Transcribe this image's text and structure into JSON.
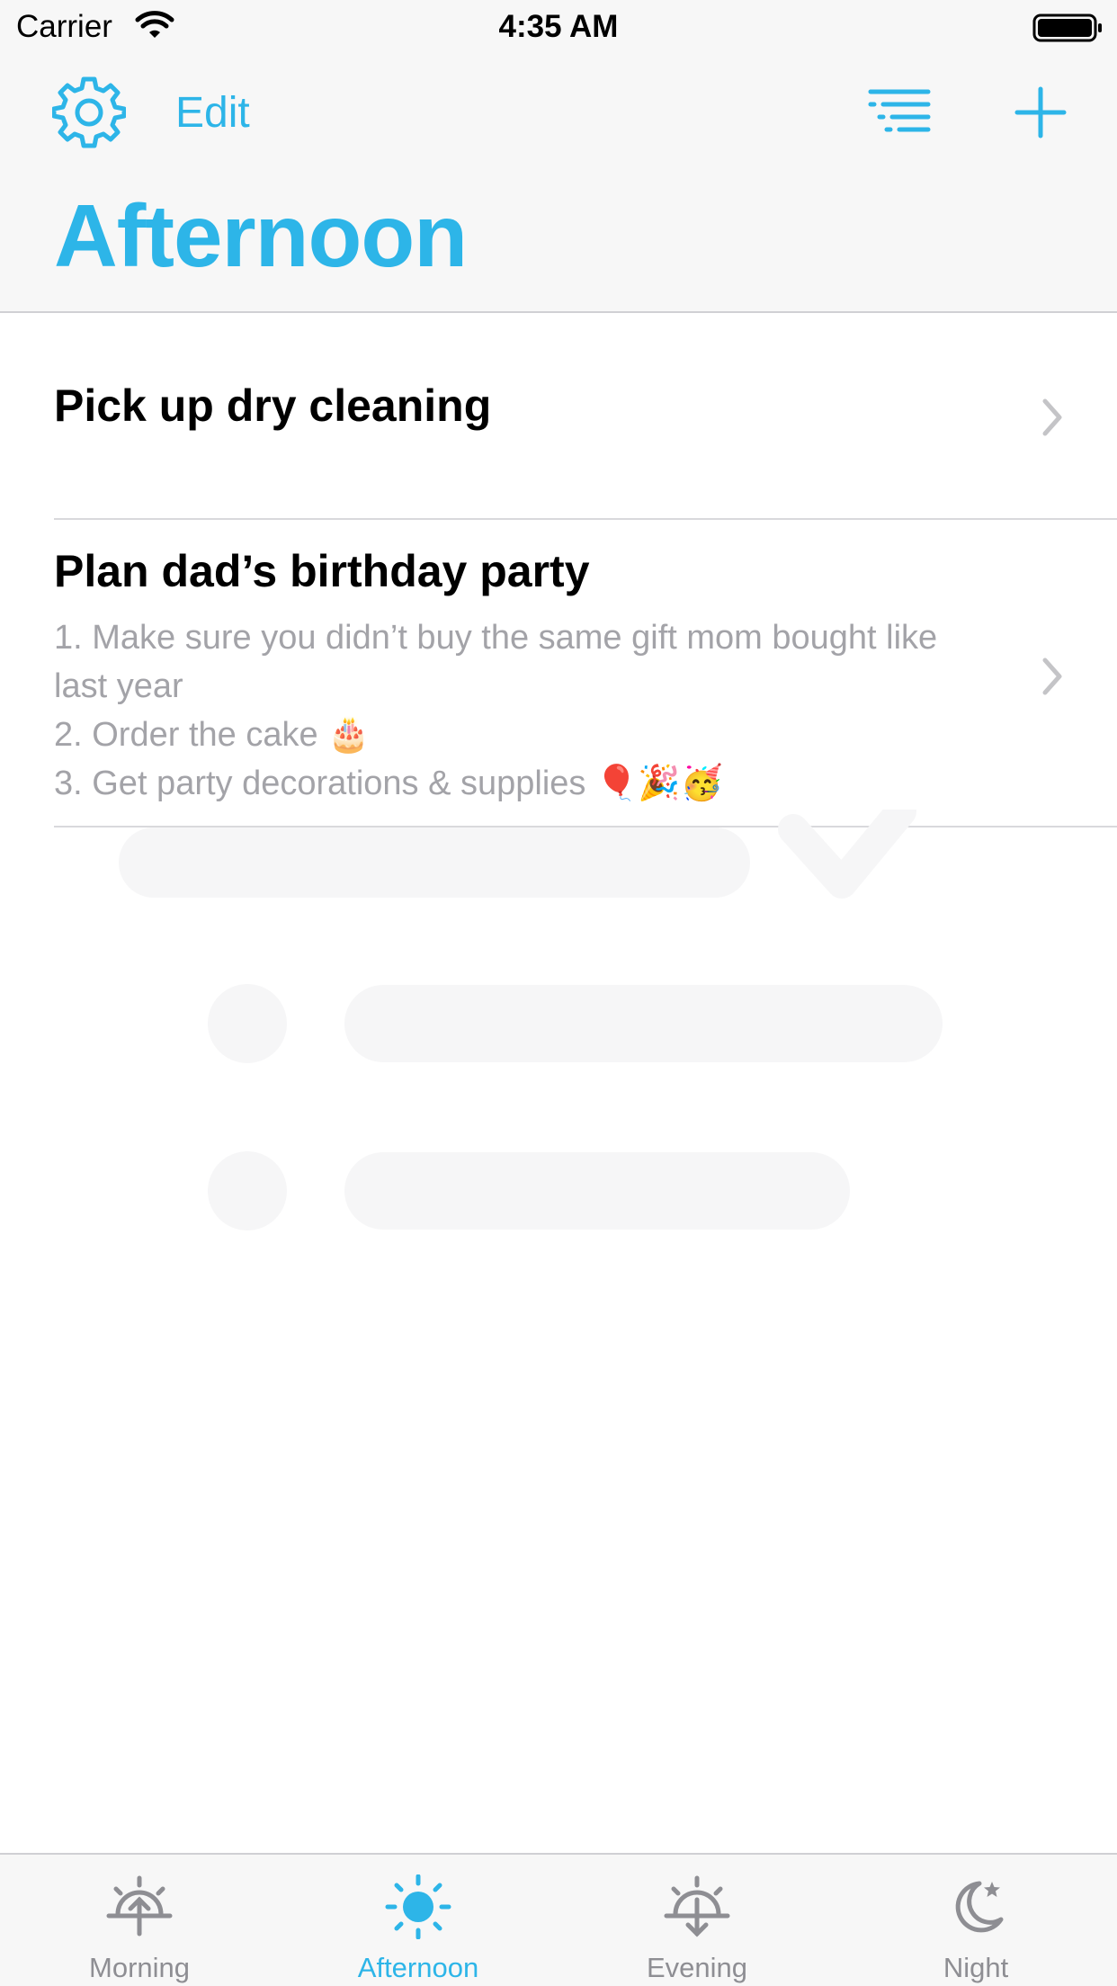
{
  "status_bar": {
    "carrier": "Carrier",
    "time": "4:35 AM"
  },
  "toolbar": {
    "edit_label": "Edit",
    "icons": [
      "gear-icon",
      "sort-icon",
      "add-icon"
    ]
  },
  "page": {
    "title": "Afternoon"
  },
  "tasks": [
    {
      "title": "Pick up dry cleaning",
      "note": ""
    },
    {
      "title": "Plan dad’s birthday party",
      "note": "1. Make sure you didn’t buy the same gift mom bought like last year\n2. Order the cake 🎂\n3. Get party decorations & supplies 🎈🎉🥳"
    }
  ],
  "tab_bar": {
    "tabs": [
      {
        "label": "Morning",
        "icon": "sunrise-icon",
        "active": false
      },
      {
        "label": "Afternoon",
        "icon": "sun-icon",
        "active": true
      },
      {
        "label": "Evening",
        "icon": "sunset-icon",
        "active": false
      },
      {
        "label": "Night",
        "icon": "moon-icon",
        "active": false
      }
    ]
  },
  "colors": {
    "accent": "#2db5e8",
    "inactive": "#8e8e93",
    "header_bg": "#f7f7f7",
    "note_text": "#a3a3a8"
  }
}
